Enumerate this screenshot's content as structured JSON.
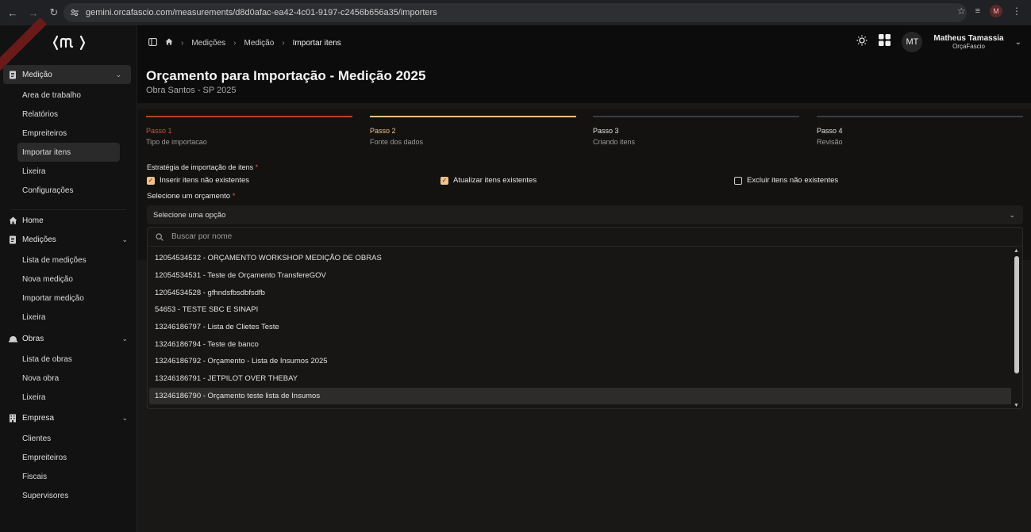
{
  "browser": {
    "url": "gemini.orcafascio.com/measurements/d8d0afac-ea42-4c01-9197-c2456b656a35/importers",
    "profile_initial": "M"
  },
  "sidebar": {
    "groups": [
      {
        "label": "Medição",
        "icon": "document-icon",
        "expanded": true,
        "items": [
          "Area de trabalho",
          "Relatórios",
          "Empreiteiros",
          "Importar itens",
          "Lixeira",
          "Configurações"
        ]
      },
      {
        "label": "Home",
        "icon": "home-icon"
      },
      {
        "label": "Medições",
        "icon": "document-icon",
        "items": [
          "Lista de medições",
          "Nova medição",
          "Importar medição",
          "Lixeira"
        ]
      },
      {
        "label": "Obras",
        "icon": "helmet-icon",
        "items": [
          "Lista de obras",
          "Nova obra",
          "Lixeira"
        ]
      },
      {
        "label": "Empresa",
        "icon": "building-icon",
        "items": [
          "Clientes",
          "Empreiteiros",
          "Fiscais",
          "Supervisores"
        ]
      }
    ]
  },
  "topbar": {
    "breadcrumb": [
      "Medições",
      "Medição",
      "Importar itens"
    ],
    "user_initials": "MT",
    "user_name": "Matheus Tamassia",
    "user_org": "OrçaFascio"
  },
  "header": {
    "title": "Orçamento para Importação - Medição 2025",
    "subtitle": "Obra Santos - SP 2025"
  },
  "steps": [
    {
      "num": "Passo 1",
      "label": "Tipo de importacao",
      "color": "#b5412b"
    },
    {
      "num": "Passo 2",
      "label": "Fonte dos dados",
      "color": "#f3c18b"
    },
    {
      "num": "Passo 3",
      "label": "Criando itens",
      "color": "#3a3c4a"
    },
    {
      "num": "Passo 4",
      "label": "Revisão",
      "color": "#3a3c4a"
    }
  ],
  "form": {
    "strategy_label": "Estratégia de importação de itens",
    "required_mark": "*",
    "options": [
      {
        "label": "Inserir itens não existentes",
        "checked": true
      },
      {
        "label": "Atualizar itens existentes",
        "checked": true
      },
      {
        "label": "Excluir itens não existentes",
        "checked": false
      }
    ],
    "budget_label": "Selecione um orçamento",
    "select_placeholder": "Selecione uma opção"
  },
  "dropdown": {
    "search_placeholder": "Buscar por nome",
    "items": [
      "12054534532 - ORÇAMENTO WORKSHOP MEDIÇÃO DE OBRAS",
      "12054534531 - Teste de Orçamento TransfereGOV",
      "12054534528 - gfhndsfbsdbfsdfb",
      "54653 - TESTE SBC E SINAPI",
      "13246186797 - Lista de Clietes Teste",
      "13246186794 - Teste de banco",
      "13246186792 - Orçamento - Lista de Insumos 2025",
      "13246186791 - JETPILOT OVER THEBAY",
      "13246186790 - Orçamento teste lista de Insumos"
    ],
    "highlighted_index": 8
  }
}
